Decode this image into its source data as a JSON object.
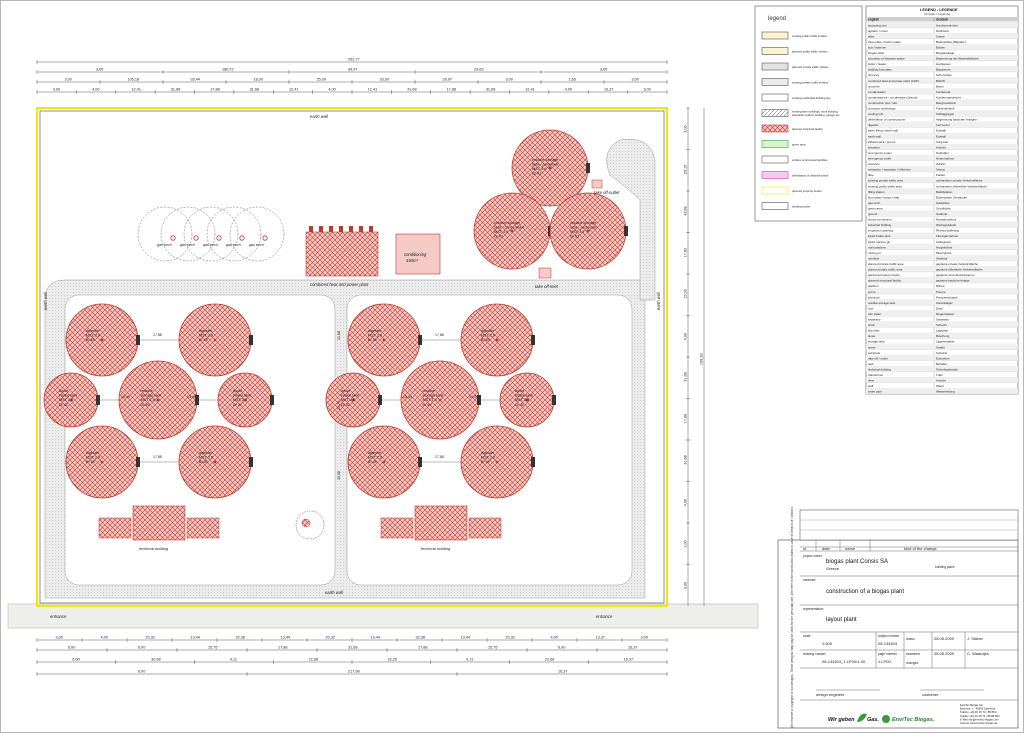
{
  "site": {
    "earth_wall_top": "earth wall",
    "earth_wall_bottom": "earth wall",
    "earth_wall_left": "earth wall",
    "earth_wall_right": "earth wall",
    "entrance_left": "entrance",
    "entrance_right": "entrance",
    "take_off_inlet": "take off-inlet",
    "take_off_outlet": "take off-outlet"
  },
  "top_area": {
    "gas_torches": [
      "gas torch",
      "gas torch",
      "gas torch",
      "gas torch",
      "gas torch"
    ],
    "chp_label": "combined heat and power plant",
    "conditioning_label": "conditioning",
    "conditioning_value": "450m³",
    "storage_permeate_left": [
      "residue storage",
      "tank - permeate",
      "MST 1,6",
      "D/ 61"
    ],
    "storage_permeate_right": [
      "residue storage",
      "tank - permeate",
      "MST 1,6",
      "D/ 61"
    ],
    "storage_concentrate": [
      "residue storage",
      "tank - concentrate",
      "MST 1,6",
      "D/ 61"
    ]
  },
  "cluster": {
    "digester": [
      "digester",
      "MST 2.8",
      "B/ 48"
    ],
    "residue": [
      "residue",
      "storage tank",
      "MST 1,6",
      "D/ 66"
    ],
    "liquid": [
      "liquid",
      "intake tank",
      "MST 1,6",
      "D/ 41"
    ],
    "technical_label": "technical building"
  },
  "dims": {
    "total_width": "252,77",
    "row2": [
      "3,00",
      "186,72",
      "39,97",
      "29,63",
      "3,00"
    ],
    "row3": [
      "3,00",
      "105,18",
      "33,44",
      "18,00",
      "25,00",
      "33,00",
      "29,97",
      "3,00",
      "1,65",
      "3,00"
    ],
    "row4": [
      "3,00",
      "4,00",
      "12,41",
      "31,68",
      "17,88",
      "31,68",
      "12,41",
      "4,00",
      "12,41",
      "31,68",
      "17,88",
      "31,68",
      "12,41",
      "4,00",
      "13,37",
      "3,00"
    ],
    "right_col": [
      "3,00",
      "29,15",
      "43,89",
      "17,82",
      "15,00",
      "4,00",
      "31,68",
      "17,88",
      "31,68",
      "4,00",
      "1,00",
      "3,00",
      "199,33"
    ],
    "bottom1": [
      "3,00",
      "4,00",
      "20,32",
      "13,44",
      "32,38",
      "13,44",
      "20,32",
      "13,44",
      "32,38",
      "13,44",
      "20,32",
      "4,00",
      "13,37",
      "3,00"
    ],
    "bottom2": [
      "6,00",
      "6,00",
      "15,75",
      "17,88",
      "31,68",
      "17,88",
      "15,75",
      "6,00",
      "16,37"
    ],
    "bottom3": [
      "6,00",
      "30,98",
      "9,11",
      "22,68",
      "18,26",
      "9,11",
      "22,68",
      "16,37"
    ],
    "bottom4": [
      "6,00",
      "217,98",
      "16,37"
    ],
    "inner": [
      "17,88",
      "13,44",
      "17,88",
      "13,44",
      "31,68",
      "25,75",
      "16,88"
    ]
  },
  "legend": {
    "title": "legend",
    "items": [
      "existing public traffic surface",
      "planned public traffic surface",
      "planned private traffic surface",
      "existing private traffic surface",
      "existing residential building line",
      "existing farm buildings, work building, lowerable outdoor building, garage etc.",
      "planned structural facility",
      "green area",
      "surface of structural facilities",
      "delimitation of distance areas",
      "planned property border",
      "building border"
    ]
  },
  "glossary": {
    "title": "LEGEND - LEGENDE",
    "subtitle": "(Circular / Legends)",
    "col_en": "english",
    "col_de": "deutsch",
    "rows": [
      [
        "accepting unit",
        "Annahmeeinheit"
      ],
      [
        "agitator / mixer",
        "Rührwerk"
      ],
      [
        "alley",
        "Gasse"
      ],
      [
        "base plate / bottom plate",
        "Bodenplatte (Behälter)"
      ],
      [
        "bolt / fastener",
        "Bolzen"
      ],
      [
        "biogas plant",
        "Biogasanlage"
      ],
      [
        "boundary of distance space",
        "Begrenzung der Abstandsfläche"
      ],
      [
        "boiler / heater",
        "Heizkessel"
      ],
      [
        "building boundary",
        "Baugrenze"
      ],
      [
        "chimney",
        "Schornstein"
      ],
      [
        "combined heat and power plant (CHP)",
        "BHKW"
      ],
      [
        "concrete",
        "Beton"
      ],
      [
        "condensation",
        "Kondensat"
      ],
      [
        "condensate pit / condensate collector",
        "Kondensatschacht"
      ],
      [
        "construction plot / site",
        "Baugrundstück"
      ],
      [
        "conveyor technology",
        "Fördertechnik"
      ],
      [
        "cooling unit",
        "Kühlaggregat"
      ],
      [
        "delimitation of constructions",
        "Abgrenzung baulicher Anlagen"
      ],
      [
        "digester",
        "Fermenter"
      ],
      [
        "earth filling / earth wall",
        "Erdwall"
      ],
      [
        "earth wall",
        "Erdwall"
      ],
      [
        "effluent tank / pre-pit",
        "Vorgrube"
      ],
      [
        "elevation",
        "Ansicht"
      ],
      [
        "emergency cooler",
        "Notkühler"
      ],
      [
        "emergency outlet",
        "Notentnahme"
      ],
      [
        "entrance",
        "Zufahrt"
      ],
      [
        "extraction / separator / influence",
        "Abzug"
      ],
      [
        "flare",
        "Fackel"
      ],
      [
        "existing private traffic area",
        "vorhandene private Verkehrsfläche"
      ],
      [
        "existing public traffic area",
        "vorhandene öffentliche Verkehrsfläche"
      ],
      [
        "filling station",
        "Befüllstation"
      ],
      [
        "floor plate / bottom slab",
        "Bodenplatte (Gebäude)"
      ],
      [
        "gas torch",
        "Gasfackel"
      ],
      [
        "green area",
        "Grünfläche"
      ],
      [
        "ground",
        "Gelände"
      ],
      [
        "house connection",
        "Hausanschluss"
      ],
      [
        "industrial building",
        "Werksgebäude"
      ],
      [
        "inspection opening",
        "Revisionsöffnung"
      ],
      [
        "liquid intake tank",
        "Flüssigannahme"
      ],
      [
        "liquid manure pit",
        "Güllegrube"
      ],
      [
        "main platform",
        "Hauptbühne"
      ],
      [
        "mixing pit",
        "Mischgrube"
      ],
      [
        "overflow",
        "Überlauf"
      ],
      [
        "planned private traffic area",
        "geplante private Verkehrsfläche"
      ],
      [
        "planned public traffic area",
        "geplante öffentliche Verkehrsfläche"
      ],
      [
        "planned property border",
        "geplante Grundstücksgrenze"
      ],
      [
        "planned structural facility",
        "geplante bauliche Anlage"
      ],
      [
        "platform",
        "Bühne"
      ],
      [
        "pump",
        "Pumpe"
      ],
      [
        "pump pit",
        "Pumpenschacht"
      ],
      [
        "residue storage tank",
        "Gärrestlager"
      ],
      [
        "roof",
        "Dach"
      ],
      [
        "rain water",
        "Regenwasser"
      ],
      [
        "separator",
        "Separator"
      ],
      [
        "shaft",
        "Schacht"
      ],
      [
        "site plan",
        "Lageplan"
      ],
      [
        "slope",
        "Böschung"
      ],
      [
        "storage tank",
        "Lagerbehälter"
      ],
      [
        "street",
        "Straße"
      ],
      [
        "substrate",
        "Substrat"
      ],
      [
        "take-off / outlet",
        "Entnahme"
      ],
      [
        "tank",
        "Behälter"
      ],
      [
        "technical building",
        "Technikgebäude"
      ],
      [
        "transformer",
        "Trafo"
      ],
      [
        "view",
        "Ansicht"
      ],
      [
        "wall",
        "Wand"
      ],
      [
        "water pipe",
        "Wasserleitung"
      ]
    ]
  },
  "titleblock": {
    "hdr_nr": "nr.",
    "hdr_date": "date",
    "hdr_name": "name",
    "hdr_kind": "kind of the change",
    "project_label": "project owner",
    "project_owner": "biogas plant Consis SA",
    "country": "Greece",
    "building_place": "building place",
    "measure_label": "measure",
    "measure": "construction of a biogas plant",
    "representation_label": "representation",
    "representation": "layout plant",
    "scale_label": "scale",
    "scale": "1:500",
    "project_number_label": "project number",
    "project_number": "08-134503",
    "drawing_number_label": "drawing number",
    "drawing_number": "08-134503_1.LP00/1-00",
    "page_number_label": "page number",
    "page_number": "1.LP00",
    "drawn_label": "drawn",
    "examined_label": "examined",
    "changed_label": "changed",
    "drawn_date": "28.05.2009",
    "drawn_name": "J. Stüber",
    "examined_date": "28.05.2009",
    "examined_name": "C. Waardjes",
    "design_engineer": "design engineer",
    "customer": "customer",
    "logo_left": "Wir geben",
    "logo_left2": "Gas.",
    "logo_right": "EnviTec Biogas.",
    "company_lines": [
      "EnviTec Biogas AG",
      "Boschstr. 2 - 48369 Saerbeck",
      "Telefon +49 (0) 25 74 / 88 88 0",
      "Telefax +49 (0) 25 74 / 88 88 800",
      "E-Mail info@envitec-biogas.com",
      "Internet www.envitec-biogas.de"
    ],
    "side_note": "We reserve a copyright of our designs. These designs may only be used for the personal use. We refer to the norms and claims in case of breach of contract."
  },
  "colors": {
    "red": "#d9534f",
    "hatch": "#c0392b",
    "road": "#e6e6e6",
    "border": "#f0e800"
  }
}
